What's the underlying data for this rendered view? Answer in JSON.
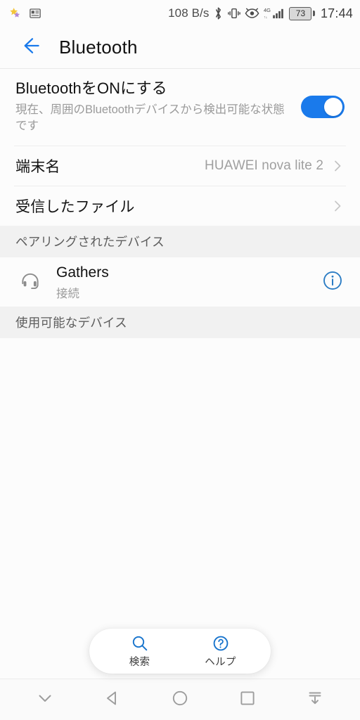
{
  "statusbar": {
    "left_icons": [
      "star-icon",
      "news-feed-icon"
    ],
    "network_speed": "108 B/s",
    "right_icons": [
      "bluetooth-icon",
      "vibrate-icon",
      "eye-comfort-icon",
      "signal-4g-icon"
    ],
    "signal_label": "4G",
    "battery_level": "73",
    "clock": "17:44"
  },
  "appbar": {
    "back_icon": "back-arrow-icon",
    "title": "Bluetooth"
  },
  "bluetooth_toggle": {
    "title": "BluetoothをONにする",
    "subtitle": "現在、周囲のBluetoothデバイスから検出可能な状態です",
    "state": "on",
    "accent_color": "#1a7aeb"
  },
  "rows": [
    {
      "label": "端末名",
      "value": "HUAWEI nova lite 2"
    },
    {
      "label": "受信したファイル",
      "value": ""
    }
  ],
  "sections": [
    {
      "header": "ペアリングされたデバイス",
      "devices": [
        {
          "icon": "headphones-icon",
          "name": "Gathers",
          "state": "接続",
          "action_icon": "info-icon"
        }
      ]
    },
    {
      "header": "使用可能なデバイス",
      "devices": []
    }
  ],
  "bottom_actions": [
    {
      "icon": "search-icon",
      "label": "検索"
    },
    {
      "icon": "help-icon",
      "label": "ヘルプ"
    }
  ],
  "navbar": [
    {
      "icon": "chevron-down-icon",
      "name": "hide-navbar"
    },
    {
      "icon": "back-triangle-icon",
      "name": "back"
    },
    {
      "icon": "home-circle-icon",
      "name": "home"
    },
    {
      "icon": "recents-square-icon",
      "name": "recents"
    },
    {
      "icon": "collapse-down-icon",
      "name": "one-hand-mode"
    }
  ],
  "colors": {
    "accent": "#1a7aeb",
    "page_bg": "#fcfcfc",
    "section_bg": "#f1f1f1",
    "muted_text": "#9a9a9a"
  }
}
